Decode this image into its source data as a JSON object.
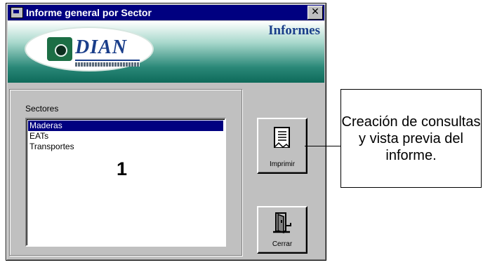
{
  "window": {
    "title": "Informe general por Sector",
    "close_label": "✕"
  },
  "banner": {
    "logo_text": "DIAN",
    "heading": "Informes"
  },
  "sectors": {
    "label": "Sectores",
    "items": [
      {
        "label": "Maderas",
        "selected": true
      },
      {
        "label": "EATs",
        "selected": false
      },
      {
        "label": "Transportes",
        "selected": false
      }
    ]
  },
  "annotation_number": "1",
  "buttons": {
    "print_label": "Imprimir",
    "close_label": "Cerrar"
  },
  "callout": {
    "text": "Creación de consultas y vista previa del informe."
  },
  "colors": {
    "titlebar": "#000080",
    "selection": "#000080",
    "banner_teal": "#2a8878",
    "dian_blue": "#1a3e8a"
  },
  "icons": {
    "window": "app-window-icon",
    "print": "document-icon",
    "close": "door-exit-icon"
  }
}
